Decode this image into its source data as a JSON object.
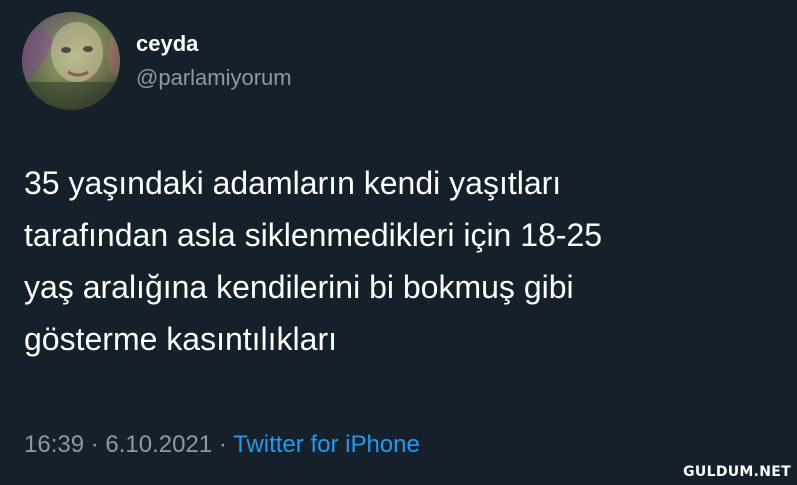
{
  "user": {
    "display_name": "ceyda",
    "handle": "@parlamiyorum",
    "avatar": "avatar-photo"
  },
  "tweet": {
    "lines": [
      "35 yaşındaki adamların kendi yaşıtları",
      "tarafından asla siklenmedikleri için 18-25",
      "yaş aralığına kendilerini bi bokmuş gibi",
      "gösterme kasıntılıkları"
    ]
  },
  "meta": {
    "time": "16:39",
    "separator": "·",
    "date": "6.10.2021",
    "source": "Twitter for iPhone"
  },
  "watermark": "GULDUM.NET",
  "colors": {
    "background": "#15202b",
    "text": "#ffffff",
    "secondary": "#8b98a5",
    "link": "#1d9bf0"
  }
}
